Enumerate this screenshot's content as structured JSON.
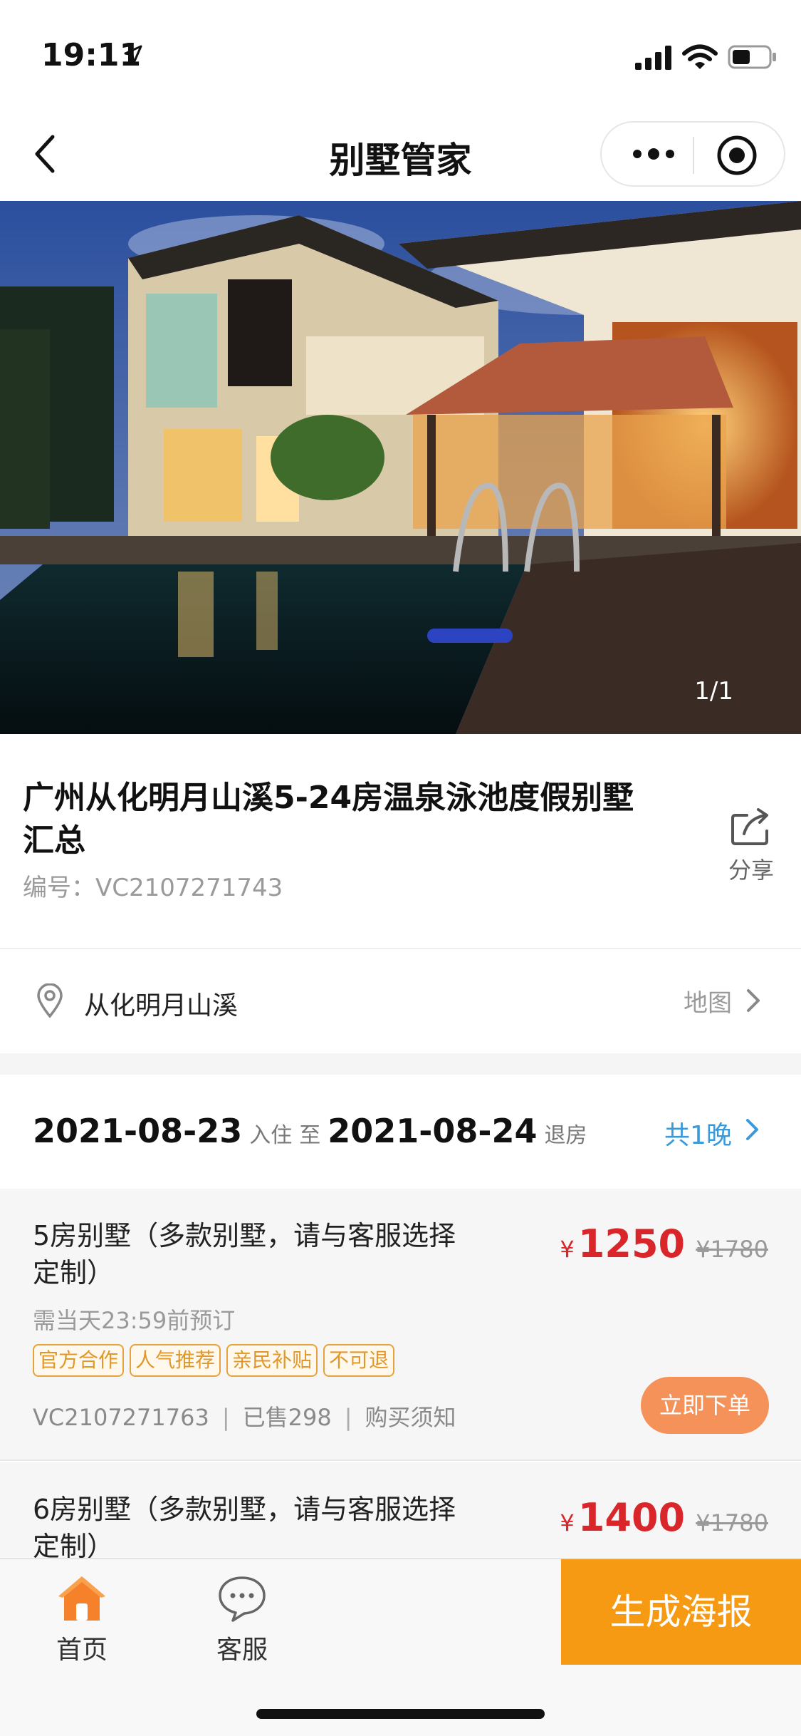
{
  "status_bar": {
    "time": "19:11"
  },
  "nav": {
    "title": "别墅管家"
  },
  "hero": {
    "counter": "1/1"
  },
  "villa": {
    "title": "广州从化明月山溪5-24房温泉泳池度假别墅汇总",
    "code": "编号：VC2107271743",
    "share_label": "分享"
  },
  "location": {
    "name": "从化明月山溪",
    "map_label": "地图"
  },
  "dates": {
    "check_in": "2021-08-23",
    "check_in_label": "入住",
    "to_label": "至",
    "check_out": "2021-08-24",
    "check_out_label": "退房",
    "nights": "共1晚"
  },
  "products": [
    {
      "name": "5房别墅（多款别墅，请与客服选择定制）",
      "currency": "¥",
      "price": "1250",
      "original_price": "¥1780",
      "deadline": "需当天23:59前预订",
      "tags": [
        "官方合作",
        "人气推荐",
        "亲民补贴",
        "不可退"
      ],
      "code": "VC2107271763",
      "sold": "已售298",
      "notice": "购买须知",
      "separator": "|",
      "order_label": "立即下单"
    },
    {
      "name": "6房别墅（多款别墅，请与客服选择定制）",
      "currency": "¥",
      "price": "1400",
      "original_price": "¥1780"
    }
  ],
  "bottom_bar": {
    "home_label": "首页",
    "service_label": "客服",
    "poster_label": "生成海报"
  },
  "colors": {
    "price_red": "#d8262a",
    "accent_orange": "#f79a13",
    "order_button": "#f4925a",
    "link_blue": "#3a9ad9",
    "tag_orange": "#e6a23c"
  },
  "icons": {
    "status": [
      "location-arrow-icon",
      "signal-icon",
      "wifi-icon",
      "battery-icon"
    ],
    "nav": [
      "back-icon",
      "more-icon",
      "close-target-icon"
    ],
    "content": [
      "share-icon",
      "location-pin-icon",
      "chevron-right-icon"
    ],
    "tabs": [
      "home-icon",
      "chat-bubble-icon"
    ]
  }
}
